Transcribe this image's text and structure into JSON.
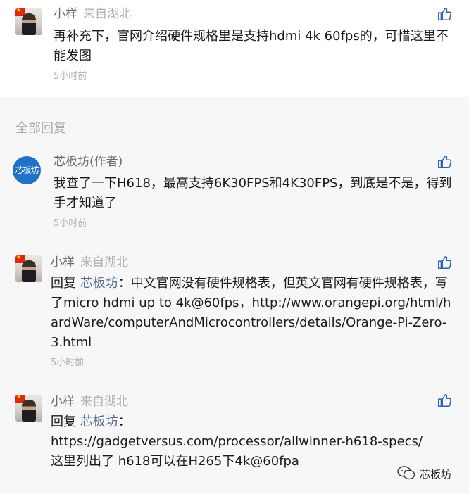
{
  "comments_top": [
    {
      "user": "小样",
      "location": "来自湖北",
      "text": "再补充下，官网介绍硬件规格里是支持hdmi 4k 60fps的，可惜这里不能发图",
      "time": "5小时前"
    }
  ],
  "section": {
    "title": "全部回复"
  },
  "replies": [
    {
      "user": "芯板坊(作者)",
      "avatar_text": "芯板坊",
      "text": "我查了一下H618，最高支持6K30FPS和4K30FPS，到底是不是，得到手才知道了",
      "time": "5小时前"
    },
    {
      "user": "小样",
      "location": "来自湖北",
      "reply_prefix": "回复",
      "reply_to": "芯板坊",
      "text": "：中文官网没有硬件规格表，但英文官网有硬件规格表，写了micro hdmi up to 4k@60fps，http://www.orangepi.org/html/hardWare/computerAndMicrocontrollers/details/Orange-Pi-Zero-3.html",
      "time": "5小时前"
    },
    {
      "user": "小样",
      "location": "来自湖北",
      "reply_prefix": "回复",
      "reply_to": "芯板坊",
      "text": "：\nhttps://gadgetversus.com/processor/allwinner-h618-specs/\n这里列出了 h618可以在H265下4k@60fpa"
    }
  ],
  "watermark": {
    "label": "芯板坊"
  },
  "colors": {
    "link": "#576b95",
    "meta": "#b2b2b2",
    "name": "#6b6b6b"
  },
  "icons": {
    "like": "thumbs-up-icon",
    "wechat": "wechat-icon"
  }
}
